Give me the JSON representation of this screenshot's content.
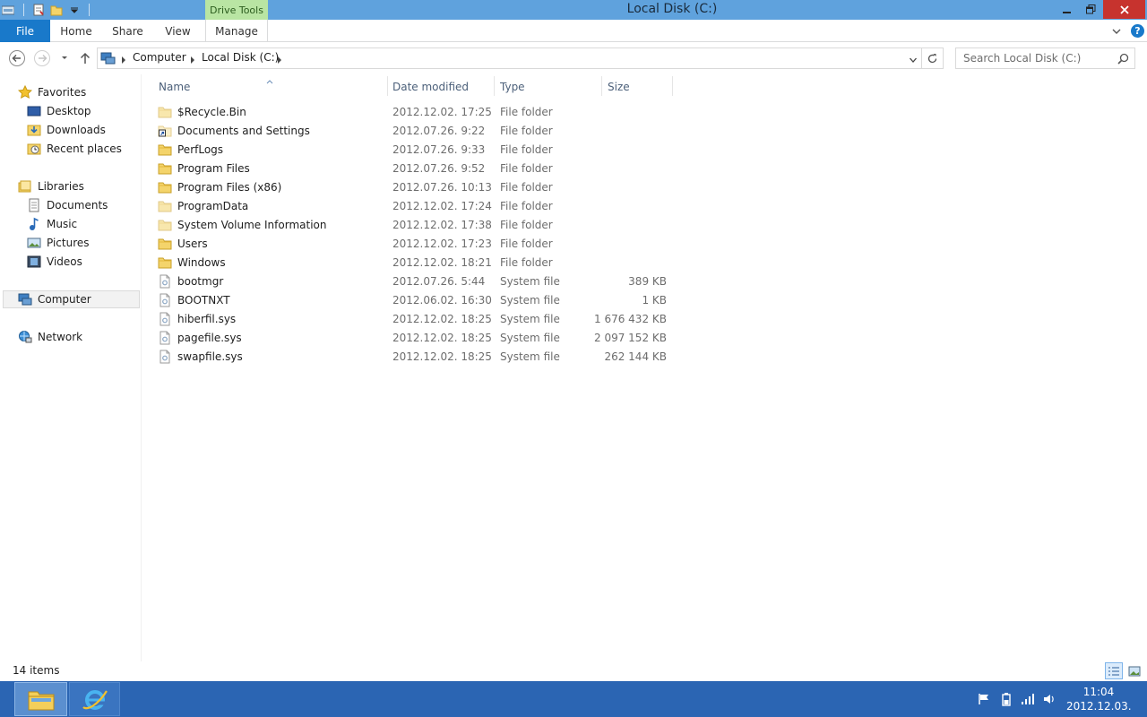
{
  "window": {
    "title": "Local Disk (C:)",
    "context_tab_group": "Drive Tools"
  },
  "ribbon": {
    "tabs": [
      "File",
      "Home",
      "Share",
      "View",
      "Manage"
    ]
  },
  "address": {
    "crumbs": [
      "Computer",
      "Local Disk (C:)"
    ],
    "search_placeholder": "Search Local Disk (C:)"
  },
  "nav": {
    "favorites": {
      "label": "Favorites",
      "items": [
        "Desktop",
        "Downloads",
        "Recent places"
      ]
    },
    "libraries": {
      "label": "Libraries",
      "items": [
        "Documents",
        "Music",
        "Pictures",
        "Videos"
      ]
    },
    "computer": "Computer",
    "network": "Network"
  },
  "columns": {
    "name": "Name",
    "date": "Date modified",
    "type": "Type",
    "size": "Size"
  },
  "files": [
    {
      "name": "$Recycle.Bin",
      "date": "2012.12.02. 17:25",
      "type": "File folder",
      "size": "",
      "icon": "folder-hidden-icon"
    },
    {
      "name": "Documents and Settings",
      "date": "2012.07.26. 9:22",
      "type": "File folder",
      "size": "",
      "icon": "shortcut-folder-icon"
    },
    {
      "name": "PerfLogs",
      "date": "2012.07.26. 9:33",
      "type": "File folder",
      "size": "",
      "icon": "folder-icon"
    },
    {
      "name": "Program Files",
      "date": "2012.07.26. 9:52",
      "type": "File folder",
      "size": "",
      "icon": "folder-icon"
    },
    {
      "name": "Program Files (x86)",
      "date": "2012.07.26. 10:13",
      "type": "File folder",
      "size": "",
      "icon": "folder-icon"
    },
    {
      "name": "ProgramData",
      "date": "2012.12.02. 17:24",
      "type": "File folder",
      "size": "",
      "icon": "folder-hidden-icon"
    },
    {
      "name": "System Volume Information",
      "date": "2012.12.02. 17:38",
      "type": "File folder",
      "size": "",
      "icon": "folder-hidden-icon"
    },
    {
      "name": "Users",
      "date": "2012.12.02. 17:23",
      "type": "File folder",
      "size": "",
      "icon": "folder-icon"
    },
    {
      "name": "Windows",
      "date": "2012.12.02. 18:21",
      "type": "File folder",
      "size": "",
      "icon": "folder-icon"
    },
    {
      "name": "bootmgr",
      "date": "2012.07.26. 5:44",
      "type": "System file",
      "size": "389 KB",
      "icon": "system-file-icon"
    },
    {
      "name": "BOOTNXT",
      "date": "2012.06.02. 16:30",
      "type": "System file",
      "size": "1 KB",
      "icon": "system-file-icon"
    },
    {
      "name": "hiberfil.sys",
      "date": "2012.12.02. 18:25",
      "type": "System file",
      "size": "1 676 432 KB",
      "icon": "system-file-icon"
    },
    {
      "name": "pagefile.sys",
      "date": "2012.12.02. 18:25",
      "type": "System file",
      "size": "2 097 152 KB",
      "icon": "system-file-icon"
    },
    {
      "name": "swapfile.sys",
      "date": "2012.12.02. 18:25",
      "type": "System file",
      "size": "262 144 KB",
      "icon": "system-file-icon"
    }
  ],
  "status": {
    "item_count": "14 items"
  },
  "taskbar": {
    "pinned": [
      "file-explorer-icon",
      "internet-explorer-icon"
    ],
    "tray_icons": [
      "action-center-flag-icon",
      "power-icon",
      "network-signal-icon",
      "volume-icon"
    ],
    "time": "11:04",
    "date": "2012.12.03."
  },
  "colors": {
    "titlebar": "#5fa2dd",
    "file_tab": "#1979ca",
    "drive_tools": "#b9e5a3",
    "close_button": "#c7332e",
    "taskbar": "#2b65b3"
  }
}
